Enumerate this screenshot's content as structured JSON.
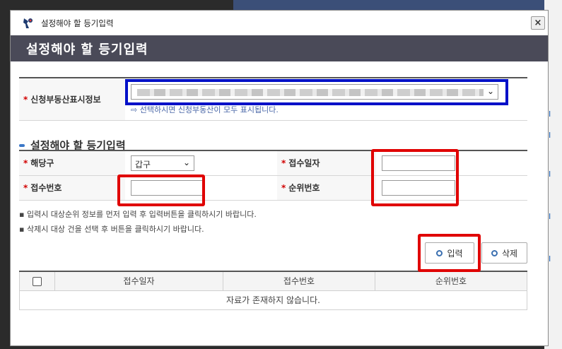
{
  "window": {
    "title": "설정해야 할 등기입력",
    "close_label": "×"
  },
  "header": {
    "heading": "설정해야 할 등기입력"
  },
  "property": {
    "label": "신청부동산표시정보",
    "hint": "선택하시면 신청부동산이 모두 표시됩니다."
  },
  "section": {
    "title": "설정해야 할 등기입력"
  },
  "form": {
    "gu_label": "해당구",
    "gu_value": "갑구",
    "receipt_date_label": "접수일자",
    "receipt_no_label": "접수번호",
    "rank_no_label": "순위번호"
  },
  "notes": [
    "입력시 대상순위 정보를 먼저 입력 후 입력버튼을 클릭하시기 바랍니다.",
    "삭제시 대상 건을 선택 후 버튼을 클릭하시기 바랍니다."
  ],
  "buttons": {
    "input": "입력",
    "delete": "삭제"
  },
  "grid": {
    "columns": [
      "접수일자",
      "접수번호",
      "순위번호"
    ],
    "empty_message": "자료가 존재하지 않습니다."
  },
  "colors": {
    "header_band": "#4a4a58",
    "highlight_blue": "#0010c8",
    "highlight_red": "#e00000"
  }
}
